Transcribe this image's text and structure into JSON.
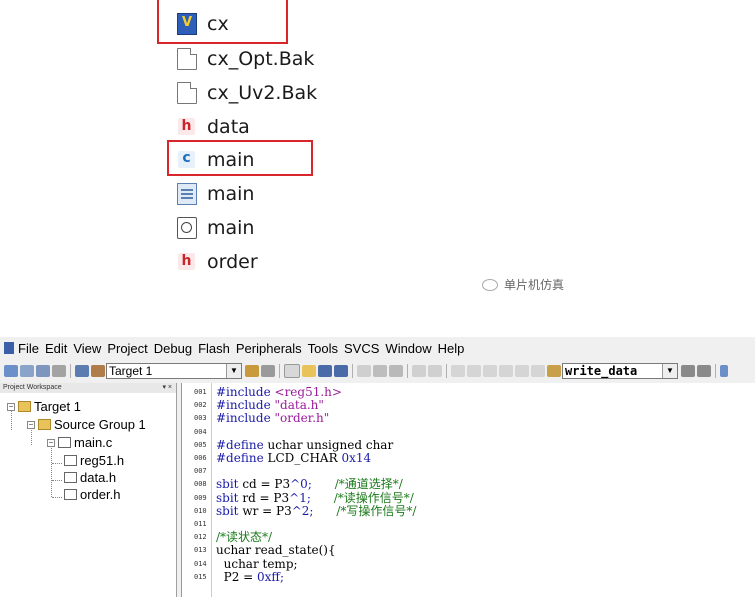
{
  "files": [
    {
      "name": "cx",
      "icon": "uvision-project-icon"
    },
    {
      "name": "cx_Opt.Bak",
      "icon": "blank-file-icon"
    },
    {
      "name": "cx_Uv2.Bak",
      "icon": "blank-file-icon"
    },
    {
      "name": "data",
      "icon": "header-file-icon"
    },
    {
      "name": "main",
      "icon": "c-source-file-icon"
    },
    {
      "name": "main",
      "icon": "text-file-icon"
    },
    {
      "name": "main",
      "icon": "object-file-icon"
    },
    {
      "name": "order",
      "icon": "header-file-icon"
    }
  ],
  "watermark": "单片机仿真",
  "highlight_color": "#d9262b",
  "menu": [
    "File",
    "Edit",
    "View",
    "Project",
    "Debug",
    "Flash",
    "Peripherals",
    "Tools",
    "SVCS",
    "Window",
    "Help"
  ],
  "toolbar": {
    "target": "Target 1",
    "find": "write_data"
  },
  "workspace": {
    "title": "Project Workspace",
    "close": "▾ ×",
    "tree": {
      "target": "Target 1",
      "group": "Source Group 1",
      "file": "main.c",
      "children": [
        "reg51.h",
        "data.h",
        "order.h"
      ]
    }
  },
  "editor": {
    "lines": [
      {
        "n": "001",
        "parts": [
          [
            "kw",
            "#include "
          ],
          [
            "str",
            "<reg51.h>"
          ]
        ]
      },
      {
        "n": "002",
        "parts": [
          [
            "kw",
            "#include "
          ],
          [
            "str",
            "\"data.h\""
          ]
        ]
      },
      {
        "n": "003",
        "parts": [
          [
            "kw",
            "#include "
          ],
          [
            "str",
            "\"order.h\""
          ]
        ]
      },
      {
        "n": "004",
        "parts": []
      },
      {
        "n": "005",
        "parts": [
          [
            "kw",
            "#define "
          ],
          [
            "plain",
            "uchar unsigned char"
          ]
        ]
      },
      {
        "n": "006",
        "parts": [
          [
            "kw",
            "#define "
          ],
          [
            "plain",
            "LCD_CHAR "
          ],
          [
            "kw",
            "0x14"
          ]
        ]
      },
      {
        "n": "007",
        "parts": []
      },
      {
        "n": "008",
        "parts": [
          [
            "kw",
            "sbit "
          ],
          [
            "plain",
            "cd = P3"
          ],
          [
            "kw",
            "^0;      "
          ],
          [
            "cm",
            "/*通道选择*/"
          ]
        ]
      },
      {
        "n": "009",
        "parts": [
          [
            "kw",
            "sbit "
          ],
          [
            "plain",
            "rd = P3"
          ],
          [
            "kw",
            "^1;      "
          ],
          [
            "cm",
            "/*读操作信号*/"
          ]
        ]
      },
      {
        "n": "010",
        "parts": [
          [
            "kw",
            "sbit "
          ],
          [
            "plain",
            "wr = P3"
          ],
          [
            "kw",
            "^2;      "
          ],
          [
            "cm",
            "/*写操作信号*/"
          ]
        ]
      },
      {
        "n": "011",
        "parts": []
      },
      {
        "n": "012",
        "parts": [
          [
            "cm",
            "/*读状态*/"
          ]
        ]
      },
      {
        "n": "013",
        "parts": [
          [
            "plain",
            "uchar read_state(){"
          ]
        ]
      },
      {
        "n": "014",
        "parts": [
          [
            "plain",
            "  uchar temp;"
          ]
        ]
      },
      {
        "n": "015",
        "parts": [
          [
            "plain",
            "  P2 = "
          ],
          [
            "kw",
            "0xff;"
          ]
        ]
      }
    ]
  }
}
